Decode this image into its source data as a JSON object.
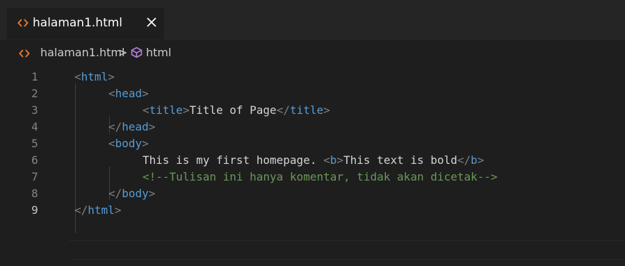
{
  "tab": {
    "label": "halaman1.html",
    "close_icon": "close-icon"
  },
  "breadcrumb": {
    "file": "halaman1.html",
    "separator": ">",
    "symbol": "html"
  },
  "editor": {
    "active_line": 9,
    "lines": [
      {
        "num": "1",
        "indent": 0,
        "tokens": [
          [
            "tg",
            "<"
          ],
          [
            "tn",
            "html"
          ],
          [
            "tg",
            ">"
          ]
        ]
      },
      {
        "num": "2",
        "indent": 1,
        "tokens": [
          [
            "tg",
            "<"
          ],
          [
            "tn",
            "head"
          ],
          [
            "tg",
            ">"
          ]
        ]
      },
      {
        "num": "3",
        "indent": 2,
        "tokens": [
          [
            "tg",
            "<"
          ],
          [
            "tn",
            "title"
          ],
          [
            "tg",
            ">"
          ],
          [
            "tx",
            "Title of Page"
          ],
          [
            "tg",
            "</"
          ],
          [
            "tn",
            "title"
          ],
          [
            "tg",
            ">"
          ]
        ]
      },
      {
        "num": "4",
        "indent": 1,
        "tokens": [
          [
            "tg",
            "</"
          ],
          [
            "tn",
            "head"
          ],
          [
            "tg",
            ">"
          ]
        ]
      },
      {
        "num": "5",
        "indent": 1,
        "tokens": [
          [
            "tg",
            "<"
          ],
          [
            "tn",
            "body"
          ],
          [
            "tg",
            ">"
          ]
        ]
      },
      {
        "num": "6",
        "indent": 2,
        "tokens": [
          [
            "tx",
            "This is my first homepage. "
          ],
          [
            "tg",
            "<"
          ],
          [
            "tn",
            "b"
          ],
          [
            "tg",
            ">"
          ],
          [
            "tx",
            "This text is bold"
          ],
          [
            "tg",
            "</"
          ],
          [
            "tn",
            "b"
          ],
          [
            "tg",
            ">"
          ]
        ]
      },
      {
        "num": "7",
        "indent": 2,
        "tokens": [
          [
            "cm",
            "<!--Tulisan ini hanya komentar, tidak akan dicetak-->"
          ]
        ]
      },
      {
        "num": "8",
        "indent": 1,
        "tokens": [
          [
            "tg",
            "</"
          ],
          [
            "tn",
            "body"
          ],
          [
            "tg",
            ">"
          ]
        ]
      },
      {
        "num": "9",
        "indent": 0,
        "tokens": [
          [
            "tg",
            "</"
          ],
          [
            "tn",
            "html"
          ],
          [
            "tg",
            ">"
          ]
        ]
      }
    ]
  },
  "colors": {
    "html_icon": "#e37933",
    "cube_icon": "#b180d7",
    "tag_bracket": "#808080",
    "tag_name": "#569cd6",
    "text": "#d4d4d4",
    "comment": "#6a9955"
  }
}
